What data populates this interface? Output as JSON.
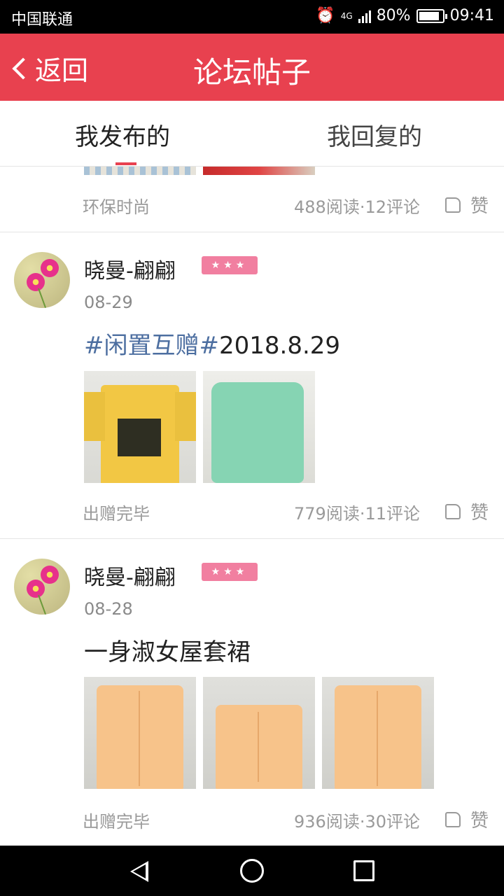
{
  "status_bar": {
    "carrier": "中国联通",
    "network": "4G",
    "battery": "80%",
    "battery_level": 0.8,
    "time": "09:41"
  },
  "header": {
    "back_label": "返回",
    "title": "论坛帖子"
  },
  "tabs": [
    {
      "label": "我发布的",
      "active": true
    },
    {
      "label": "我回复的",
      "active": false
    }
  ],
  "colors": {
    "accent": "#e8414f",
    "badge": "#f17fa0",
    "hashtag": "#4c6ea0"
  },
  "badge_stars": "★★★",
  "like_label": "赞",
  "posts": [
    {
      "tag": "环保时尚",
      "stats": "488阅读·12评论"
    },
    {
      "author": "晓曼-翩翩",
      "date": "08-29",
      "hashtag": "#闲置互赠#",
      "title_text": "2018.8.29",
      "tag": "出赠完毕",
      "stats": "779阅读·11评论"
    },
    {
      "author": "晓曼-翩翩",
      "date": "08-28",
      "title_text": "一身淑女屋套裙",
      "tag": "出赠完毕",
      "stats": "936阅读·30评论"
    }
  ]
}
